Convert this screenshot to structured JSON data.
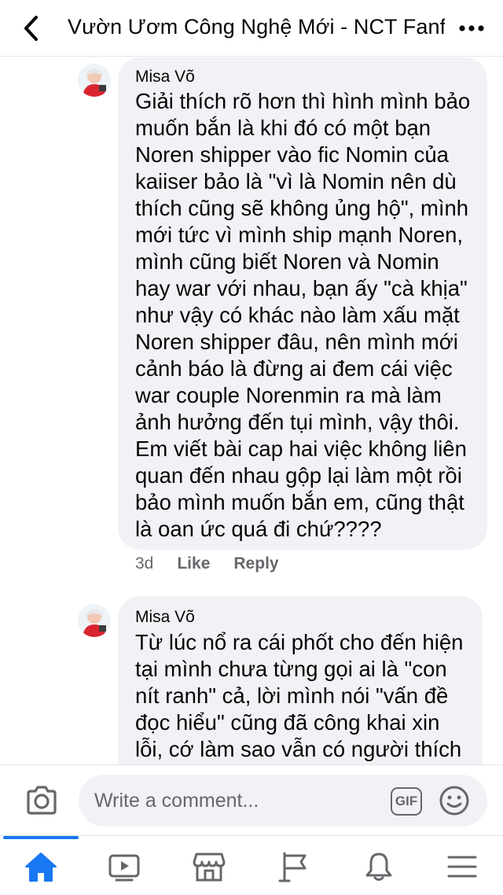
{
  "header": {
    "title": "Vườn Ươm Công Nghệ Mới - NCT Fanfic...",
    "back_icon": "chevron-left-icon",
    "more_icon": "more-dots-icon"
  },
  "comments": [
    {
      "author": "Misa Võ",
      "lines": [
        "Giải thích rõ hơn thì hình mình bảo",
        "muốn bắn là khi đó có một bạn",
        "Noren shipper vào fic Nomin của",
        "kaiiser bảo là \"vì là Nomin nên dù",
        "thích cũng sẽ không ủng hộ\", mình",
        "mới tức vì mình ship mạnh Noren,",
        "mình cũng biết Noren và Nomin",
        "hay war với nhau, bạn ấy \"cà khịa\"",
        "như vậy có khác nào làm xấu mặt",
        "Noren shipper đâu, nên mình mới",
        "cảnh báo là đừng ai đem cái việc",
        "war couple Norenmin ra mà làm",
        "ảnh hưởng đến tụi mình, vậy thôi.",
        "Em viết bài cap hai việc không liên",
        "quan đến nhau gộp lại làm một rồi",
        "bảo mình muốn bắn em, cũng thật",
        "là oan ức quá đi chứ????"
      ],
      "time": "3d",
      "like_label": "Like",
      "reply_label": "Reply"
    },
    {
      "author": "Misa Võ",
      "lines": [
        "Từ lúc nổ ra cái phốt cho đến hiện",
        "tại mình chưa từng gọi ai là \"con",
        "nít ranh\" cả, lời mình nói \"vấn đề",
        "đọc hiểu\" cũng đã công khai xin",
        "lỗi, cớ làm sao vẫn có người thích"
      ]
    }
  ],
  "composer": {
    "placeholder": "Write a comment...",
    "gif_label": "GIF",
    "camera_icon": "camera-icon",
    "emoji_icon": "emoji-icon"
  },
  "nav": {
    "items": [
      "home-icon",
      "video-icon",
      "marketplace-icon",
      "pages-flag-icon",
      "notifications-bell-icon",
      "menu-icon"
    ],
    "active_color": "#1877f2",
    "inactive_color": "#65676b"
  }
}
